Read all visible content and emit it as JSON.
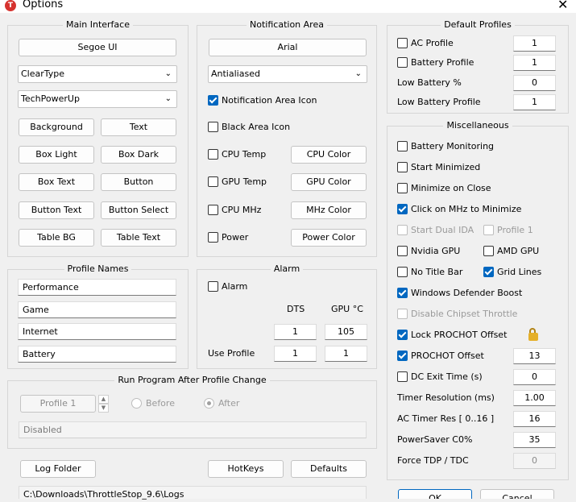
{
  "window": {
    "title": "Options",
    "icon_letter": "T",
    "close_glyph": "✕"
  },
  "main_interface": {
    "title": "Main Interface",
    "font_button": "Segoe UI",
    "render_select": "ClearType",
    "theme_select": "TechPowerUp",
    "color_buttons": [
      "Background",
      "Text",
      "Box Light",
      "Box Dark",
      "Box Text",
      "Button",
      "Button Text",
      "Button Select",
      "Table BG",
      "Table Text"
    ]
  },
  "notification_area": {
    "title": "Notification Area",
    "font_button": "Arial",
    "render_select": "Antialiased",
    "notification_icon": {
      "label": "Notification Area Icon",
      "checked": true
    },
    "black_area_icon": {
      "label": "Black Area Icon",
      "checked": false
    },
    "rows": [
      {
        "label": "CPU Temp",
        "button": "CPU Color"
      },
      {
        "label": "GPU Temp",
        "button": "GPU Color"
      },
      {
        "label": "CPU MHz",
        "button": "MHz Color"
      },
      {
        "label": "Power",
        "button": "Power Color"
      }
    ]
  },
  "profile_names": {
    "title": "Profile Names",
    "names": [
      "Performance",
      "Game",
      "Internet",
      "Battery"
    ]
  },
  "alarm": {
    "title": "Alarm",
    "alarm_label": "Alarm",
    "col_dts": "DTS",
    "col_gpu": "GPU °C",
    "dts_value": "1",
    "gpu_value": "105",
    "use_profile_label": "Use Profile",
    "use_profile_dts": "1",
    "use_profile_gpu": "1"
  },
  "run_program": {
    "title": "Run Program After Profile Change",
    "profile": "Profile 1",
    "before_label": "Before",
    "after_label": "After",
    "path": "Disabled"
  },
  "footer": {
    "log_folder": "Log Folder",
    "hotkeys": "HotKeys",
    "defaults": "Defaults",
    "log_path": "C:\\Downloads\\ThrottleStop_9.6\\Logs",
    "ok": "OK",
    "cancel": "Cancel"
  },
  "default_profiles": {
    "title": "Default Profiles",
    "rows": [
      {
        "label": "AC Profile",
        "value": "1",
        "checkbox": true
      },
      {
        "label": "Battery Profile",
        "value": "1",
        "checkbox": true
      },
      {
        "label": "Low Battery %",
        "value": "0",
        "checkbox": false
      },
      {
        "label": "Low Battery Profile",
        "value": "1",
        "checkbox": false
      }
    ]
  },
  "misc": {
    "title": "Miscellaneous",
    "battery_monitoring": "Battery Monitoring",
    "start_minimized": "Start Minimized",
    "minimize_on_close": "Minimize on Close",
    "click_mhz": "Click on MHz to Minimize",
    "start_dual_ida": "Start Dual IDA",
    "profile1": "Profile 1",
    "nvidia_gpu": "Nvidia GPU",
    "amd_gpu": "AMD GPU",
    "no_title_bar": "No Title Bar",
    "grid_lines": "Grid Lines",
    "defender_boost": "Windows Defender Boost",
    "disable_chipset": "Disable Chipset Throttle",
    "lock_prochot": "Lock PROCHOT Offset",
    "prochot_offset": "PROCHOT Offset",
    "prochot_value": "13",
    "dc_exit_time": "DC Exit Time (s)",
    "dc_exit_value": "0",
    "timer_resolution": "Timer Resolution (ms)",
    "timer_resolution_value": "1.00",
    "ac_timer_res": "AC Timer Res [ 0..16 ]",
    "ac_timer_value": "16",
    "powersaver": "PowerSaver C0%",
    "powersaver_value": "35",
    "force_tdp": "Force TDP / TDC",
    "force_tdp_value": "0"
  }
}
